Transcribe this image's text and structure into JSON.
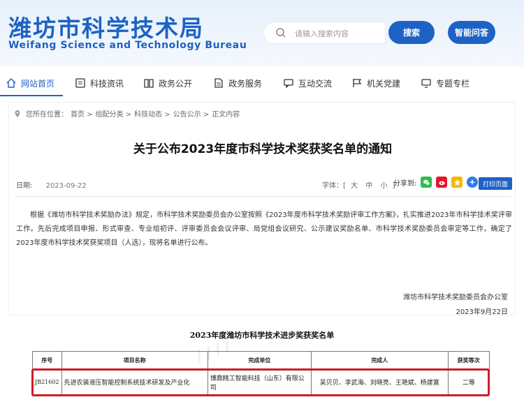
{
  "header": {
    "logo_cn": "潍坊市科学技术局",
    "logo_en": "Weifang Science and Technology Bureau",
    "search_placeholder": "请输入搜索内容",
    "search_button": "搜索",
    "qa_button": "智能问答"
  },
  "nav": [
    {
      "label": "网站首页",
      "icon": "home-icon"
    },
    {
      "label": "科技资讯",
      "icon": "news-icon"
    },
    {
      "label": "政务公开",
      "icon": "book-icon"
    },
    {
      "label": "政务服务",
      "icon": "doc-icon"
    },
    {
      "label": "互动交流",
      "icon": "chat-icon"
    },
    {
      "label": "机关党建",
      "icon": "flag-icon"
    },
    {
      "label": "专题专栏",
      "icon": "monitor-icon"
    }
  ],
  "breadcrumb": {
    "prefix": "您所在位置：",
    "items": [
      "首页 >",
      "组配分类 >",
      "科技动态 >",
      "公告公示 >",
      "正文内容"
    ]
  },
  "article": {
    "title": "关于公布2023年度市科学技术奖获奖名单的通知",
    "date_label": "日期:",
    "date": "2023-09-22",
    "font_label": "字体：[",
    "font_sizes": [
      "大",
      "中",
      "小"
    ],
    "font_end": "]",
    "share_label": "分享到:",
    "print_label": "打印页面",
    "body": "根据《潍坊市科学技术奖励办法》规定，市科学技术奖励委员会办公室按照《2023年度市科学技术奖励评审工作方案》，扎实推进2023年市科学技术奖评审工作。先后完成项目申报、形式审查、专业组初评、评审委员会会议评审、局党组会议研究、公示建议奖励名单、市科学技术奖励委员会审定等工作，确定了2023年度市科学技术奖获奖项目（人选），现将名单进行公布。",
    "signature": "潍坊市科学技术奖励委员会办公室",
    "sign_date": "2023年9月22日"
  },
  "doc": {
    "title": "2023年度潍坊市科学技术进步奖获奖名单",
    "columns": [
      "序号",
      "项目名称",
      "完成单位",
      "完成人",
      "获奖等次"
    ],
    "rows": [
      [
        "JB21602",
        "先进农装液压智能控制系统技术研发及产业化",
        "博鼎精工智能科技（山东）有限公司",
        "吴贝贝、李武海、刘晓亮、王艳斌、杨建富",
        "二等"
      ]
    ]
  },
  "colors": {
    "brand": "#1d62c4",
    "highlight": "#d11a2a"
  }
}
